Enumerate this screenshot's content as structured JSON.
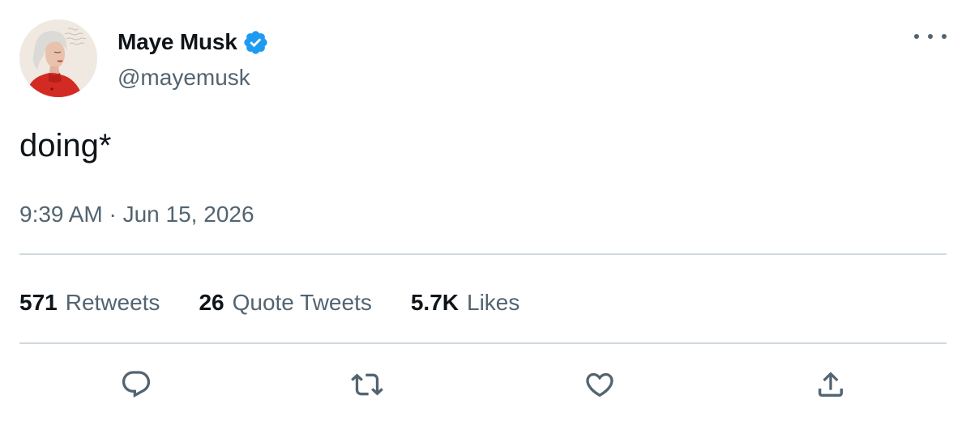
{
  "user": {
    "display_name": "Maye Musk",
    "handle": "@mayemusk",
    "verified_icon": "verified-badge-icon",
    "verified_color": "#1d9bf0"
  },
  "tweet": {
    "text": "doing*",
    "timestamp": "9:39 AM · Jun 15, 2026"
  },
  "stats": [
    {
      "count": "571",
      "label": "Retweets"
    },
    {
      "count": "26",
      "label": "Quote Tweets"
    },
    {
      "count": "5.7K",
      "label": "Likes"
    }
  ],
  "actions": [
    {
      "name": "reply-icon"
    },
    {
      "name": "retweet-icon"
    },
    {
      "name": "like-icon"
    },
    {
      "name": "share-icon"
    }
  ],
  "colors": {
    "text_primary": "#0f1419",
    "text_secondary": "#536471",
    "divider": "#cfd9de",
    "avatar_jacket": "#d42a24"
  }
}
